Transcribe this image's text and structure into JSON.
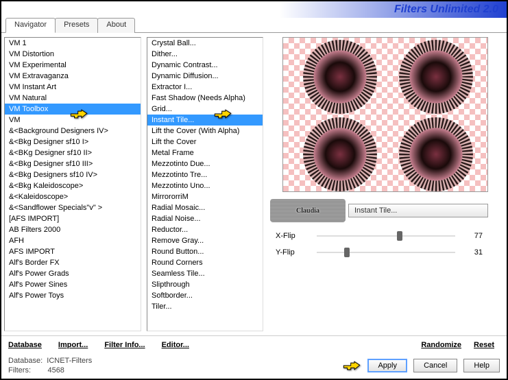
{
  "app": {
    "title": "Filters Unlimited 2.0"
  },
  "tabs": [
    "Navigator",
    "Presets",
    "About"
  ],
  "categories": [
    "VM 1",
    "VM Distortion",
    "VM Experimental",
    "VM Extravaganza",
    "VM Instant Art",
    "VM Natural",
    "VM Toolbox",
    "VM",
    "&<Background Designers IV>",
    "&<Bkg Designer sf10 I>",
    "&<BKg Designer sf10 II>",
    "&<Bkg Designer sf10 III>",
    "&<Bkg Designers sf10 IV>",
    "&<Bkg Kaleidoscope>",
    "&<Kaleidoscope>",
    "&<Sandflower Specials\"v\" >",
    "[AFS IMPORT]",
    "AB Filters 2000",
    "AFH",
    "AFS IMPORT",
    "Alf's Border FX",
    "Alf's Power Grads",
    "Alf's Power Sines",
    "Alf's Power Toys"
  ],
  "selected_category_index": 6,
  "filters": [
    "Crystal Ball...",
    "Dither...",
    "Dynamic Contrast...",
    "Dynamic Diffusion...",
    "Extractor I...",
    "Fast Shadow (Needs Alpha)",
    "Grid...",
    "Instant Tile...",
    "Lift the Cover (With Alpha)",
    "Lift the Cover",
    "Metal Frame",
    "Mezzotinto Due...",
    "Mezzotinto Tre...",
    "Mezzotinto Uno...",
    "MirrororriM",
    "Radial Mosaic...",
    "Radial Noise...",
    "Reductor...",
    "Remove Gray...",
    "Round Button...",
    "Round Corners",
    "Seamless Tile...",
    "Slipthrough",
    "Softborder...",
    "Tiler..."
  ],
  "selected_filter_index": 7,
  "current_filter": "Instant Tile...",
  "watermark": "Claudia",
  "sliders": [
    {
      "label": "X-Flip",
      "value": 77
    },
    {
      "label": "Y-Flip",
      "value": 31
    }
  ],
  "links": {
    "database": "Database",
    "import": "Import...",
    "filter_info": "Filter Info...",
    "editor": "Editor...",
    "randomize": "Randomize",
    "reset": "Reset"
  },
  "buttons": {
    "apply": "Apply",
    "cancel": "Cancel",
    "help": "Help"
  },
  "status": {
    "db_label": "Database:",
    "db_value": "ICNET-Filters",
    "filters_label": "Filters:",
    "filters_count": "4568"
  }
}
